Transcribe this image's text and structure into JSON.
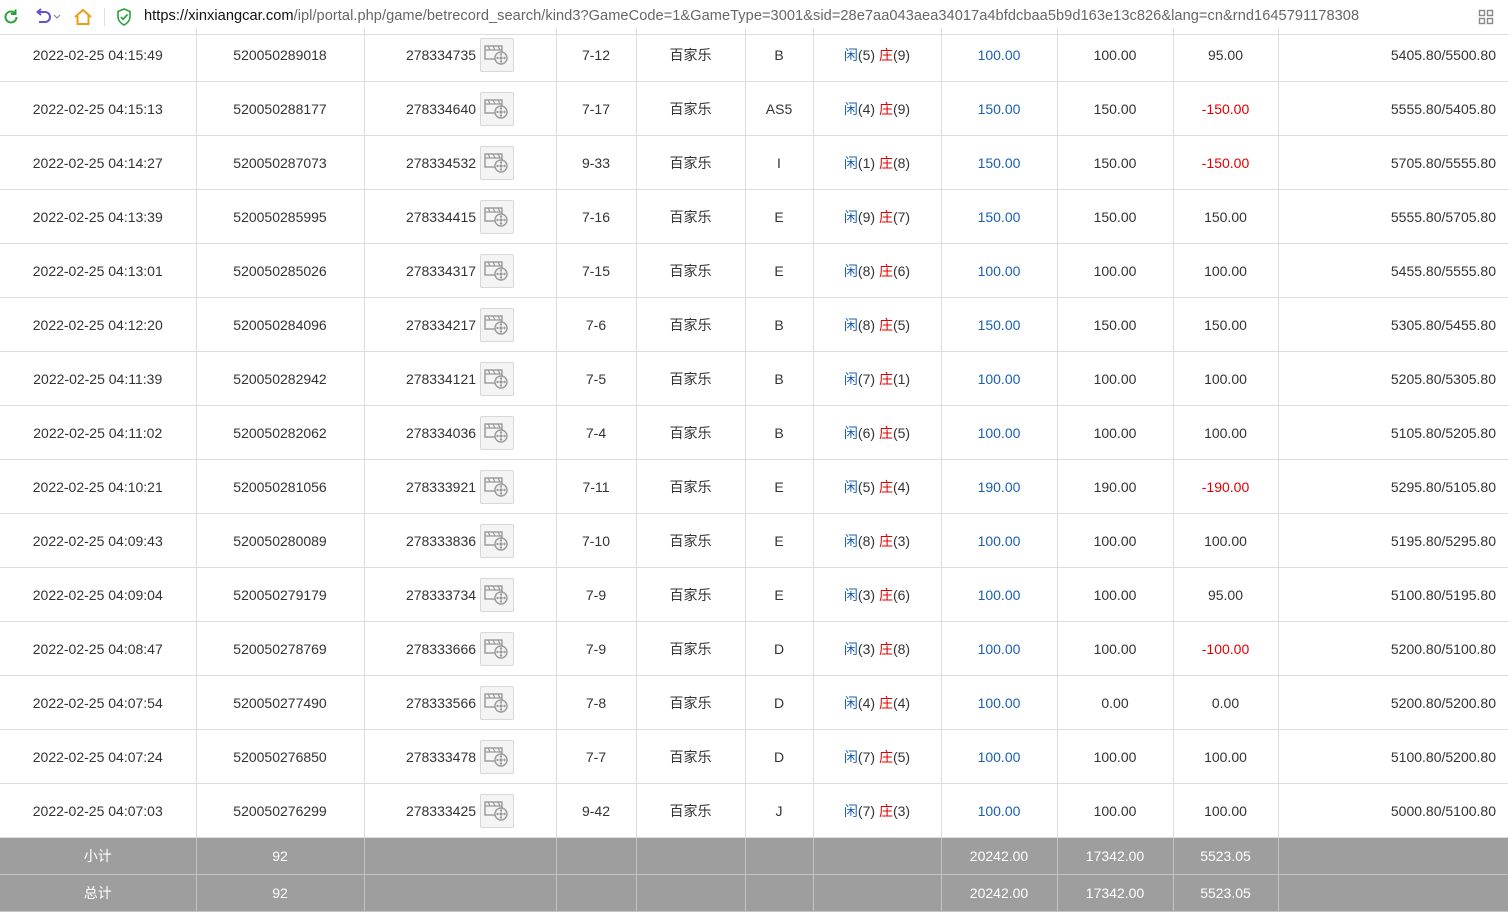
{
  "browser": {
    "url_host": "https://xinxiangcar.com",
    "url_path": "/ipl/portal.php/game/betrecord_search/kind3?GameCode=1&GameType=3001&sid=28e7aa043aea34017a4bfdcbaa5b9d163e13c826&lang=cn&rnd1645791178308",
    "colors": {
      "refresh": "#2aa23a",
      "back": "#6b4fc8",
      "home": "#e8a01a",
      "secure": "#2aa23a"
    },
    "icons": [
      "refresh-icon",
      "back-icon",
      "dropdown-icon",
      "home-icon",
      "secure-shield-icon",
      "apps-grid-icon"
    ]
  },
  "game_name": "百家乐",
  "result_labels": {
    "player": "闲",
    "banker": "庄"
  },
  "rows": [
    {
      "time": "2022-02-25 04:15:49",
      "bet_id": "520050289018",
      "game_no": "278334735",
      "shoe": "7-12",
      "table": "B",
      "player": "(5)",
      "banker": "(9)",
      "bet": "100.00",
      "valid": "100.00",
      "winloss": "95.00",
      "winloss_neg": false,
      "balance": "5405.80/5500.80"
    },
    {
      "time": "2022-02-25 04:15:13",
      "bet_id": "520050288177",
      "game_no": "278334640",
      "shoe": "7-17",
      "table": "AS5",
      "player": "(4)",
      "banker": "(9)",
      "bet": "150.00",
      "valid": "150.00",
      "winloss": "-150.00",
      "winloss_neg": true,
      "balance": "5555.80/5405.80"
    },
    {
      "time": "2022-02-25 04:14:27",
      "bet_id": "520050287073",
      "game_no": "278334532",
      "shoe": "9-33",
      "table": "I",
      "player": "(1)",
      "banker": "(8)",
      "bet": "150.00",
      "valid": "150.00",
      "winloss": "-150.00",
      "winloss_neg": true,
      "balance": "5705.80/5555.80"
    },
    {
      "time": "2022-02-25 04:13:39",
      "bet_id": "520050285995",
      "game_no": "278334415",
      "shoe": "7-16",
      "table": "E",
      "player": "(9)",
      "banker": "(7)",
      "bet": "150.00",
      "valid": "150.00",
      "winloss": "150.00",
      "winloss_neg": false,
      "balance": "5555.80/5705.80"
    },
    {
      "time": "2022-02-25 04:13:01",
      "bet_id": "520050285026",
      "game_no": "278334317",
      "shoe": "7-15",
      "table": "E",
      "player": "(8)",
      "banker": "(6)",
      "bet": "100.00",
      "valid": "100.00",
      "winloss": "100.00",
      "winloss_neg": false,
      "balance": "5455.80/5555.80"
    },
    {
      "time": "2022-02-25 04:12:20",
      "bet_id": "520050284096",
      "game_no": "278334217",
      "shoe": "7-6",
      "table": "B",
      "player": "(8)",
      "banker": "(5)",
      "bet": "150.00",
      "valid": "150.00",
      "winloss": "150.00",
      "winloss_neg": false,
      "balance": "5305.80/5455.80"
    },
    {
      "time": "2022-02-25 04:11:39",
      "bet_id": "520050282942",
      "game_no": "278334121",
      "shoe": "7-5",
      "table": "B",
      "player": "(7)",
      "banker": "(1)",
      "bet": "100.00",
      "valid": "100.00",
      "winloss": "100.00",
      "winloss_neg": false,
      "balance": "5205.80/5305.80"
    },
    {
      "time": "2022-02-25 04:11:02",
      "bet_id": "520050282062",
      "game_no": "278334036",
      "shoe": "7-4",
      "table": "B",
      "player": "(6)",
      "banker": "(5)",
      "bet": "100.00",
      "valid": "100.00",
      "winloss": "100.00",
      "winloss_neg": false,
      "balance": "5105.80/5205.80"
    },
    {
      "time": "2022-02-25 04:10:21",
      "bet_id": "520050281056",
      "game_no": "278333921",
      "shoe": "7-11",
      "table": "E",
      "player": "(5)",
      "banker": "(4)",
      "bet": "190.00",
      "valid": "190.00",
      "winloss": "-190.00",
      "winloss_neg": true,
      "balance": "5295.80/5105.80"
    },
    {
      "time": "2022-02-25 04:09:43",
      "bet_id": "520050280089",
      "game_no": "278333836",
      "shoe": "7-10",
      "table": "E",
      "player": "(8)",
      "banker": "(3)",
      "bet": "100.00",
      "valid": "100.00",
      "winloss": "100.00",
      "winloss_neg": false,
      "balance": "5195.80/5295.80"
    },
    {
      "time": "2022-02-25 04:09:04",
      "bet_id": "520050279179",
      "game_no": "278333734",
      "shoe": "7-9",
      "table": "E",
      "player": "(3)",
      "banker": "(6)",
      "bet": "100.00",
      "valid": "100.00",
      "winloss": "95.00",
      "winloss_neg": false,
      "balance": "5100.80/5195.80"
    },
    {
      "time": "2022-02-25 04:08:47",
      "bet_id": "520050278769",
      "game_no": "278333666",
      "shoe": "7-9",
      "table": "D",
      "player": "(3)",
      "banker": "(8)",
      "bet": "100.00",
      "valid": "100.00",
      "winloss": "-100.00",
      "winloss_neg": true,
      "balance": "5200.80/5100.80"
    },
    {
      "time": "2022-02-25 04:07:54",
      "bet_id": "520050277490",
      "game_no": "278333566",
      "shoe": "7-8",
      "table": "D",
      "player": "(4)",
      "banker": "(4)",
      "bet": "100.00",
      "valid": "0.00",
      "winloss": "0.00",
      "winloss_neg": false,
      "balance": "5200.80/5200.80"
    },
    {
      "time": "2022-02-25 04:07:24",
      "bet_id": "520050276850",
      "game_no": "278333478",
      "shoe": "7-7",
      "table": "D",
      "player": "(7)",
      "banker": "(5)",
      "bet": "100.00",
      "valid": "100.00",
      "winloss": "100.00",
      "winloss_neg": false,
      "balance": "5100.80/5200.80"
    },
    {
      "time": "2022-02-25 04:07:03",
      "bet_id": "520050276299",
      "game_no": "278333425",
      "shoe": "9-42",
      "table": "J",
      "player": "(7)",
      "banker": "(3)",
      "bet": "100.00",
      "valid": "100.00",
      "winloss": "100.00",
      "winloss_neg": false,
      "balance": "5000.80/5100.80"
    }
  ],
  "subtotal": {
    "label": "小计",
    "count": "92",
    "bet": "20242.00",
    "valid": "17342.00",
    "winloss": "5523.05"
  },
  "total": {
    "label": "总计",
    "count": "92",
    "bet": "20242.00",
    "valid": "17342.00",
    "winloss": "5523.05"
  }
}
